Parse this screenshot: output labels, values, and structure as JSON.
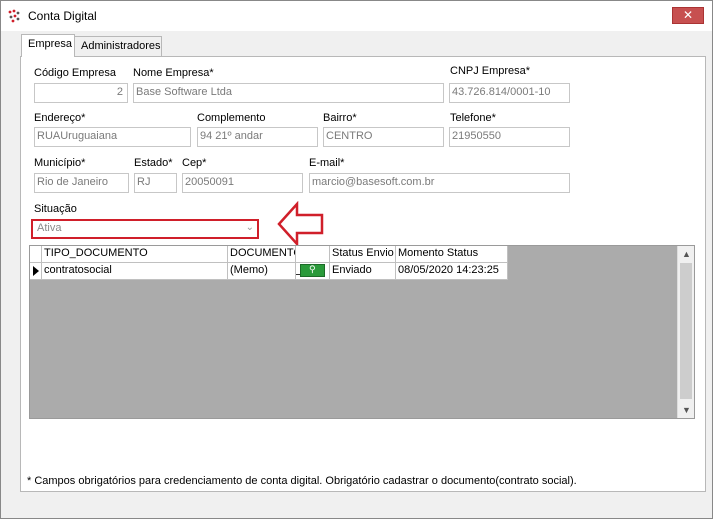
{
  "window": {
    "title": "Conta Digital",
    "close_glyph": "✕"
  },
  "tabs": [
    {
      "label": "Empresa",
      "active": true
    },
    {
      "label": "Administradores",
      "active": false
    }
  ],
  "form": {
    "codigo_empresa": {
      "label": "Código Empresa",
      "value": "2"
    },
    "nome_empresa": {
      "label": "Nome Empresa*",
      "value": "Base Software Ltda"
    },
    "cnpj": {
      "label": "CNPJ Empresa*",
      "value": "43.726.814/0001-10"
    },
    "endereco": {
      "label": "Endereço*",
      "value": "RUAUruguaiana"
    },
    "complemento": {
      "label": "Complemento",
      "value": "94 21º andar"
    },
    "bairro": {
      "label": "Bairro*",
      "value": "CENTRO"
    },
    "telefone": {
      "label": "Telefone*",
      "value": "21950550"
    },
    "municipio": {
      "label": "Município*",
      "value": "Rio de Janeiro"
    },
    "estado": {
      "label": "Estado*",
      "value": "RJ"
    },
    "cep": {
      "label": "Cep*",
      "value": "20050091"
    },
    "email": {
      "label": "E-mail*",
      "value": "marcio@basesoft.com.br"
    },
    "situacao": {
      "label": "Situação",
      "value": "Ativa",
      "highlight_color": "#d01f2a"
    }
  },
  "grid": {
    "columns": [
      "TIPO_DOCUMENTO",
      "DOCUMENTO",
      "",
      "Status Envio",
      "Momento Status"
    ],
    "rows": [
      {
        "tipo_documento": "contratosocial",
        "documento": "(Memo)",
        "status_envio": "Enviado",
        "momento_status": "08/05/2020 14:23:25"
      }
    ],
    "button_icon": "search-icon"
  },
  "footnote": "* Campos obrigatórios para credenciamento de conta digital. Obrigatório cadastrar o documento(contrato social).",
  "annotation": {
    "color": "#d01f2a",
    "icon": "left-arrow-annotation"
  }
}
